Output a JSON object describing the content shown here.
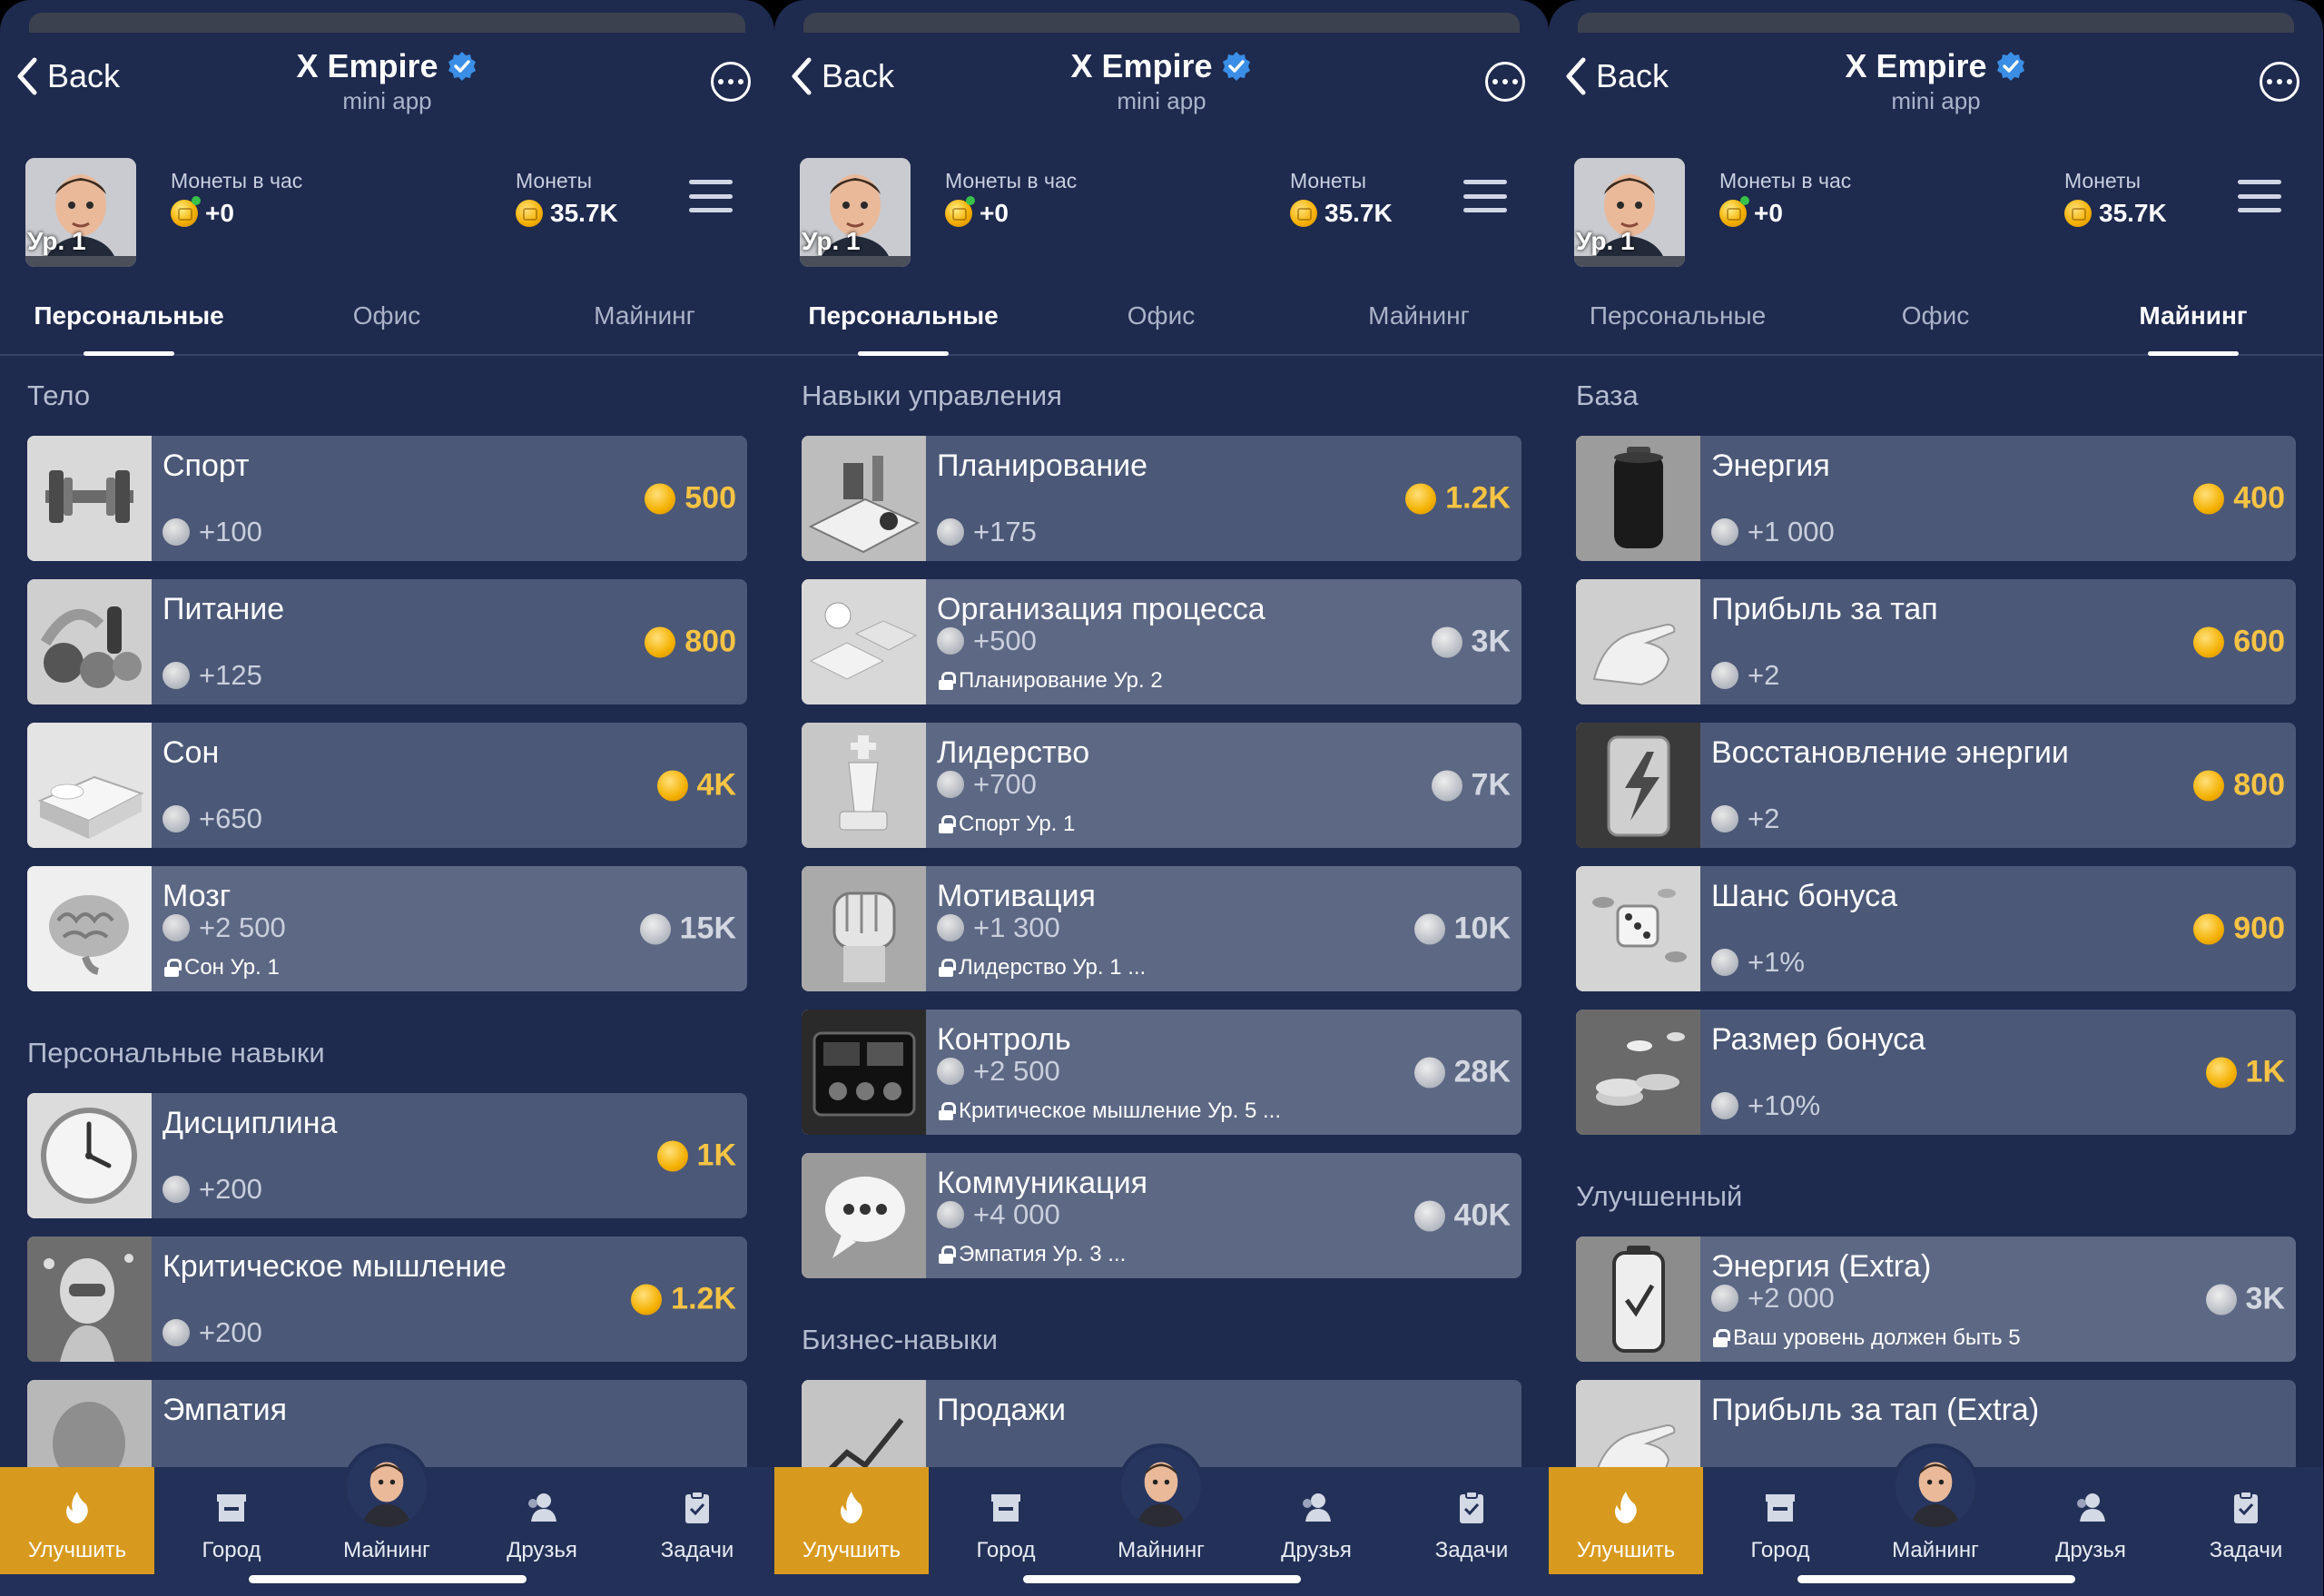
{
  "header": {
    "back_label": "Back",
    "title": "X Empire",
    "subtitle": "mini app"
  },
  "profile": {
    "level_label": "Ур. 1",
    "level_progress_pct": 0,
    "per_hour_label": "Монеты в час",
    "per_hour_value": "+0",
    "coins_label": "Монеты",
    "coins_value": "35.7K"
  },
  "tabs": [
    "Персональные",
    "Офис",
    "Майнинг"
  ],
  "panels": [
    {
      "active_tab": 0,
      "sections": [
        {
          "title": "Тело",
          "cards": [
            {
              "name": "Спорт",
              "gain": "+100",
              "price": "500",
              "icon": "dumbbell-icon"
            },
            {
              "name": "Питание",
              "gain": "+125",
              "price": "800",
              "icon": "fruits-icon"
            },
            {
              "name": "Сон",
              "gain": "+650",
              "price": "4K",
              "icon": "bed-icon"
            },
            {
              "name": "Мозг",
              "gain": "+2 500",
              "price": "15K",
              "lock": "Сон Ур. 1",
              "icon": "brain-icon"
            }
          ]
        },
        {
          "title": "Персональные навыки",
          "cards": [
            {
              "name": "Дисциплина",
              "gain": "+200",
              "price": "1K",
              "icon": "clock-icon"
            },
            {
              "name": "Критическое мышление",
              "gain": "+200",
              "price": "1.2K",
              "icon": "thinker-icon"
            },
            {
              "name": "Эмпатия",
              "gain": "",
              "price": "",
              "icon": "face-icon"
            }
          ]
        }
      ]
    },
    {
      "active_tab": 0,
      "sections": [
        {
          "title": "Навыки управления",
          "cards": [
            {
              "name": "Планирование",
              "gain": "+175",
              "price": "1.2K",
              "icon": "planning-icon"
            },
            {
              "name": "Организация процесса",
              "gain": "+500",
              "price": "3K",
              "lock": "Планирование Ур. 2",
              "icon": "organization-icon"
            },
            {
              "name": "Лидерство",
              "gain": "+700",
              "price": "7K",
              "lock": "Спорт Ур. 1",
              "icon": "chess-king-icon"
            },
            {
              "name": "Мотивация",
              "gain": "+1 300",
              "price": "10K",
              "lock": "Лидерство Ур. 1    ...",
              "icon": "fist-icon"
            },
            {
              "name": "Контроль",
              "gain": "+2 500",
              "price": "28K",
              "lock": "Критическое мышление Ур. 5    ...",
              "icon": "control-panel-icon"
            },
            {
              "name": "Коммуникация",
              "gain": "+4 000",
              "price": "40K",
              "lock": "Эмпатия Ур. 3    ...",
              "icon": "speech-bubble-icon"
            }
          ]
        },
        {
          "title": "Бизнес-навыки",
          "cards": [
            {
              "name": "Продажи",
              "gain": "",
              "price": "",
              "icon": "sales-chart-icon"
            }
          ]
        }
      ]
    },
    {
      "active_tab": 2,
      "sections": [
        {
          "title": "База",
          "cards": [
            {
              "name": "Энергия",
              "gain": "+1 000",
              "price": "400",
              "icon": "battery-icon"
            },
            {
              "name": "Прибыль за тап",
              "gain": "+2",
              "price": "600",
              "icon": "hand-tap-icon"
            },
            {
              "name": "Восстановление энергии",
              "gain": "+2",
              "price": "800",
              "icon": "energy-can-icon"
            },
            {
              "name": "Шанс бонуса",
              "gain": "+1%",
              "price": "900",
              "icon": "dice-icon"
            },
            {
              "name": "Размер бонуса",
              "gain": "+10%",
              "price": "1K",
              "icon": "coins-pile-icon"
            }
          ]
        },
        {
          "title": "Улучшенный",
          "cards": [
            {
              "name": "Энергия (Extra)",
              "gain": "+2 000",
              "price": "3K",
              "lock": "Ваш уровень должен быть 5",
              "icon": "battery-charge-icon"
            },
            {
              "name": "Прибыль за тап (Extra)",
              "gain": "",
              "price": "",
              "icon": "hand-tap-icon"
            }
          ]
        }
      ]
    }
  ],
  "bottom_nav": [
    "Улучшить",
    "Город",
    "Майнинг",
    "Друзья",
    "Задачи"
  ],
  "colors": {
    "background": "#1e2a4e",
    "card": "#4b5877",
    "accent_gold": "#f6c344",
    "nav_active": "#d89a1e"
  }
}
